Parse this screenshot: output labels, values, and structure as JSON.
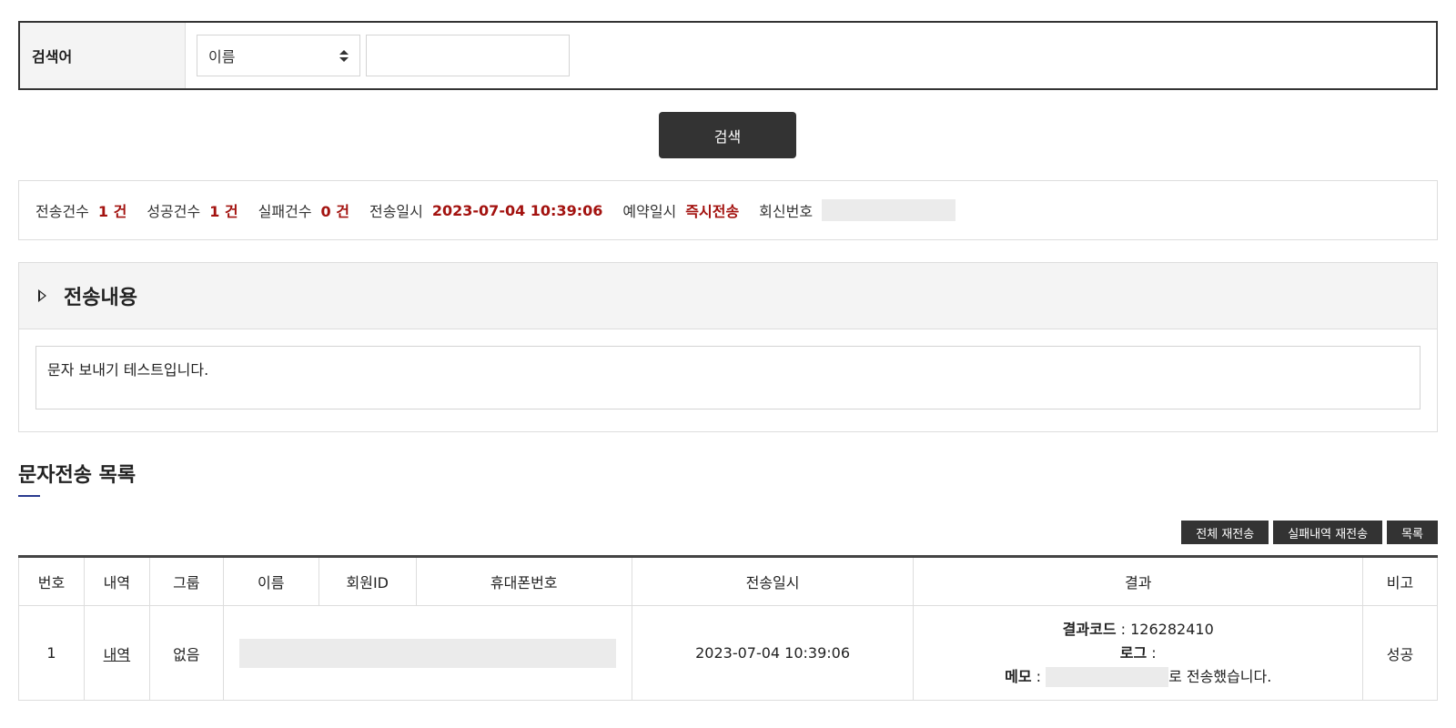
{
  "search": {
    "label": "검색어",
    "field_select": "이름",
    "input_value": "",
    "button": "검색"
  },
  "stats": {
    "sent_label": "전송건수",
    "sent_value": "1 건",
    "success_label": "성공건수",
    "success_value": "1 건",
    "fail_label": "실패건수",
    "fail_value": "0 건",
    "sent_at_label": "전송일시",
    "sent_at_value": "2023-07-04 10:39:06",
    "reserve_label": "예약일시",
    "reserve_value": "즉시전송",
    "reply_label": "회신번호"
  },
  "content": {
    "title": "전송내용",
    "message": "문자 보내기 테스트입니다."
  },
  "list": {
    "title": "문자전송 목록",
    "buttons": {
      "resend_all": "전체 재전송",
      "resend_failed": "실패내역 재전송",
      "list": "목록"
    },
    "columns": [
      "번호",
      "내역",
      "그룹",
      "이름",
      "회원ID",
      "휴대폰번호",
      "전송일시",
      "결과",
      "비고"
    ],
    "rows": [
      {
        "no": "1",
        "detail": "내역",
        "group": "없음",
        "sent_at": "2023-07-04 10:39:06",
        "result_code_label": "결과코드",
        "result_code": " : 126282410",
        "log_label": "로그",
        "log_value": " :",
        "memo_label": "메모",
        "memo_sep": " : ",
        "memo_suffix": "로 전송했습니다.",
        "note": "성공"
      }
    ]
  },
  "colors": {
    "accent_red": "#a3120f",
    "dark_button": "#333333",
    "title_underline": "#2a3a8f"
  }
}
